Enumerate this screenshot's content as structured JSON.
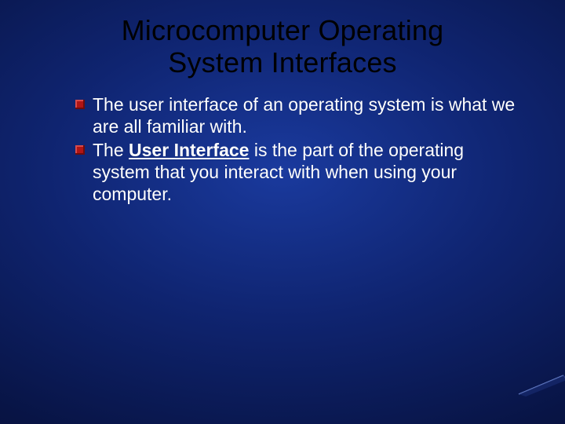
{
  "slide": {
    "title_line1": "Microcomputer Operating",
    "title_line2": "System Interfaces",
    "bullets": [
      {
        "pre": "The user interface of an operating system is what we are all familiar with.",
        "underline": "",
        "post": ""
      },
      {
        "pre": "The ",
        "underline": "User Interface",
        "post": " is the part of the operating system that you interact with when using your computer."
      }
    ]
  },
  "colors": {
    "bullet": "#b01515",
    "text": "#ffffff",
    "title": "#000000"
  }
}
